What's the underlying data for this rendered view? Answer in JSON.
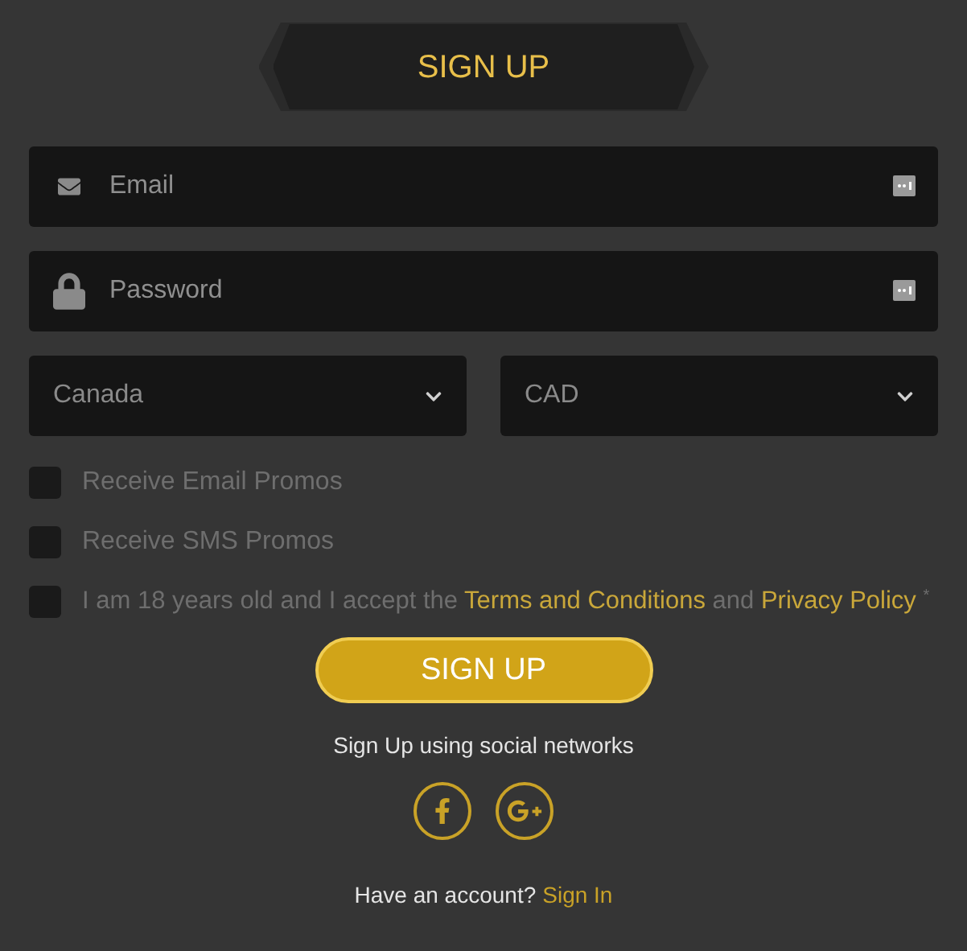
{
  "header_tab": {
    "label": "SIGN UP"
  },
  "fields": [
    {
      "kind": "email",
      "placeholder": "Email"
    },
    {
      "kind": "password",
      "placeholder": "Password"
    }
  ],
  "selects": [
    {
      "value": "Canada"
    },
    {
      "value": "CAD"
    }
  ],
  "checkboxes": [
    {
      "kind": "plain",
      "label": "Receive Email Promos",
      "checked": false
    },
    {
      "kind": "plain",
      "label": "Receive SMS Promos",
      "checked": false
    },
    {
      "kind": "terms",
      "label": "I am 18 years old and I accept the",
      "link_1": "Terms and Conditions",
      "joiner": "and",
      "link_2": "Privacy Policy",
      "required_mark": "*",
      "checked": false
    }
  ],
  "submit_button": "SIGN UP",
  "social_caption": "Sign Up using social networks",
  "social_buttons": [
    {
      "kind": "facebook"
    },
    {
      "kind": "google-plus"
    }
  ],
  "footer": {
    "text": "Have an account?",
    "link": "Sign In"
  }
}
